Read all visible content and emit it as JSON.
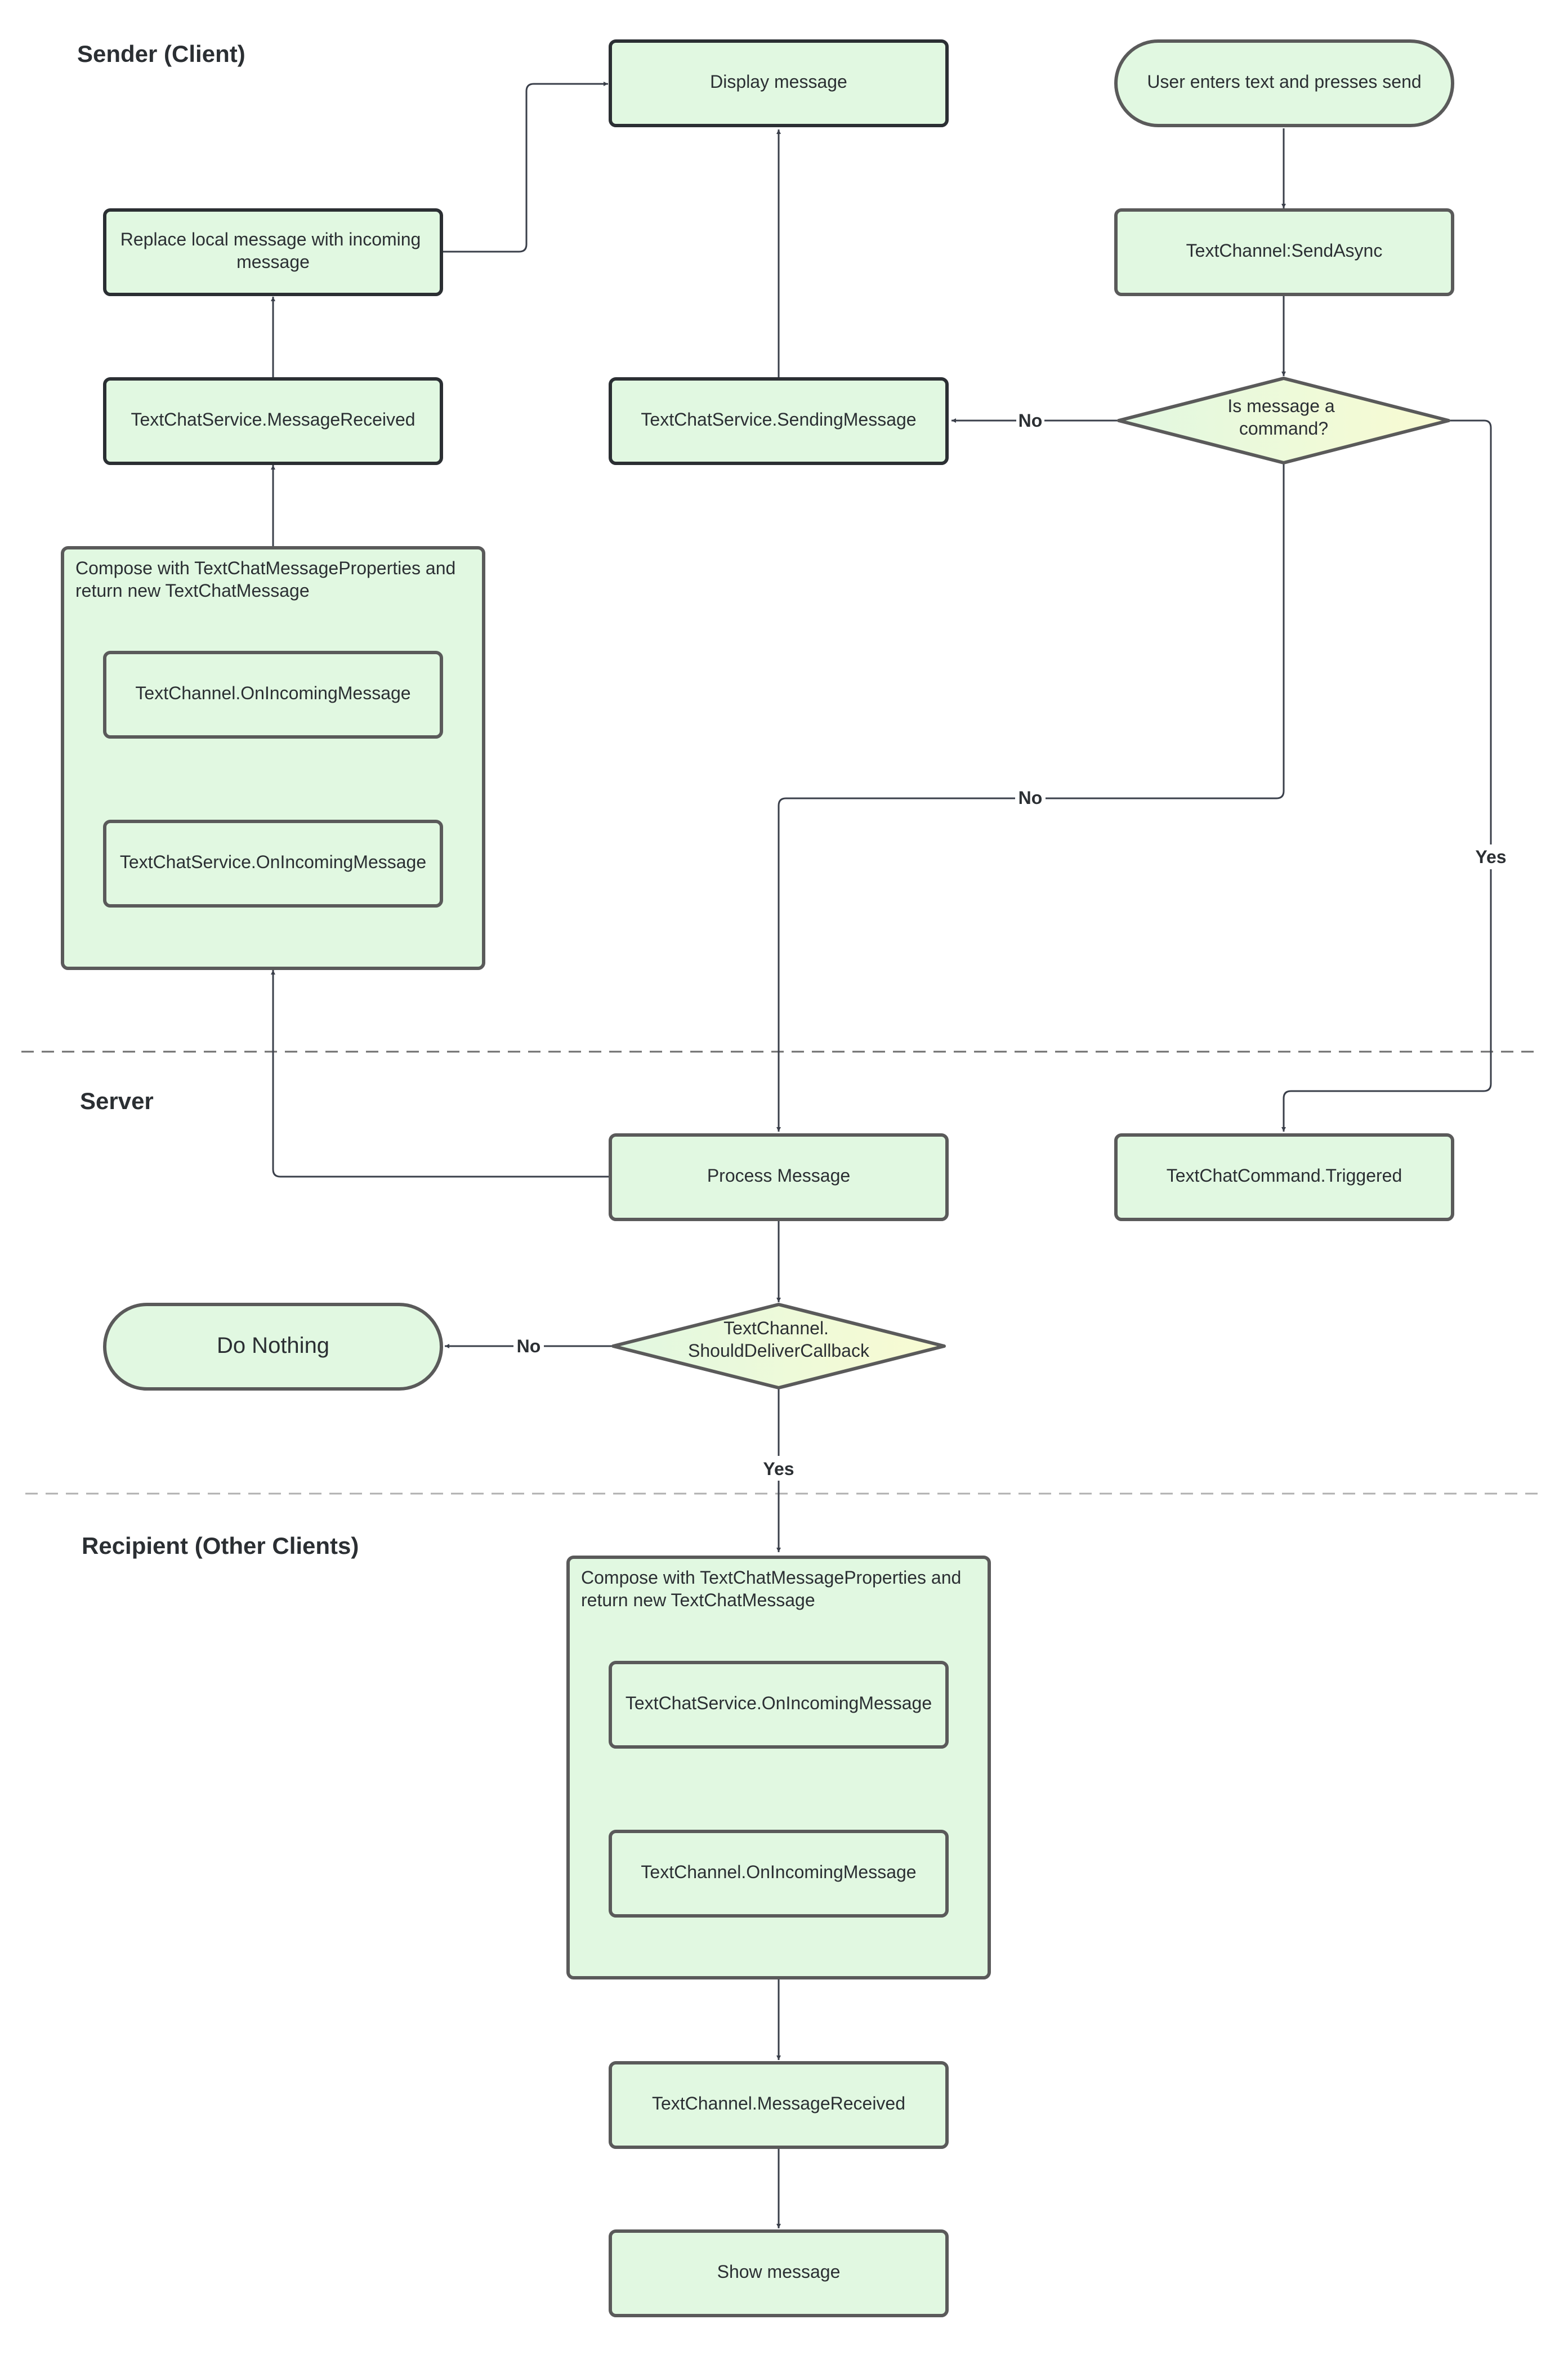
{
  "colors": {
    "node_fill": "#e1f8e1",
    "node_stroke": "#5a5a5a",
    "node_stroke_dark": "#2b2f33",
    "diamond_fill_left": "#e1f8e1",
    "diamond_fill_right": "#f9fbd2",
    "edge": "#3a3f4a",
    "lane_divider": "#8a8a8a"
  },
  "lanes": [
    {
      "id": "sender",
      "title": "Sender (Client)"
    },
    {
      "id": "server",
      "title": "Server"
    },
    {
      "id": "recipient",
      "title": "Recipient (Other Clients)"
    }
  ],
  "nodes": {
    "display_message": {
      "label": "Display message",
      "shape": "process"
    },
    "user_enters_text": {
      "label": "User enters text and presses send",
      "shape": "terminator"
    },
    "replace_local": {
      "label": [
        "Replace local message with incoming",
        "message"
      ],
      "shape": "process"
    },
    "send_async": {
      "label": "TextChannel:SendAsync",
      "shape": "process"
    },
    "chat_message_received": {
      "label": "TextChatService.MessageReceived",
      "shape": "process"
    },
    "sending_message": {
      "label": "TextChatService.SendingMessage",
      "shape": "process"
    },
    "is_command": {
      "label": [
        "Is message a",
        "command?"
      ],
      "shape": "decision"
    },
    "sender_compose_group": {
      "label": [
        "Compose with TextChatMessageProperties and",
        "return new TextChatMessage"
      ],
      "shape": "group"
    },
    "sender_channel_incoming": {
      "label": "TextChannel.OnIncomingMessage",
      "shape": "process"
    },
    "sender_service_incoming": {
      "label": "TextChatService.OnIncomingMessage",
      "shape": "process"
    },
    "process_message": {
      "label": "Process Message",
      "shape": "process"
    },
    "command_triggered": {
      "label": "TextChatCommand.Triggered",
      "shape": "process"
    },
    "should_deliver": {
      "label": [
        "TextChannel.",
        "ShouldDeliverCallback"
      ],
      "shape": "decision"
    },
    "do_nothing": {
      "label": "Do Nothing",
      "shape": "terminator"
    },
    "recipient_compose_group": {
      "label": [
        "Compose with TextChatMessageProperties and",
        "return new TextChatMessage"
      ],
      "shape": "group"
    },
    "recipient_service_incoming": {
      "label": "TextChatService.OnIncomingMessage",
      "shape": "process"
    },
    "recipient_channel_incoming": {
      "label": "TextChannel.OnIncomingMessage",
      "shape": "process"
    },
    "channel_message_received": {
      "label": "TextChannel.MessageReceived",
      "shape": "process"
    },
    "show_message": {
      "label": "Show message",
      "shape": "process"
    }
  },
  "edges": [
    {
      "from": "user_enters_text",
      "to": "send_async",
      "label": ""
    },
    {
      "from": "send_async",
      "to": "is_command",
      "label": ""
    },
    {
      "from": "is_command",
      "to": "sending_message",
      "label": "No"
    },
    {
      "from": "is_command",
      "to": "process_message",
      "label": "No"
    },
    {
      "from": "is_command",
      "to": "command_triggered",
      "label": "Yes"
    },
    {
      "from": "sending_message",
      "to": "display_message",
      "label": ""
    },
    {
      "from": "process_message",
      "to": "sender_compose_group",
      "label": ""
    },
    {
      "from": "sender_service_incoming",
      "to": "sender_channel_incoming",
      "label": ""
    },
    {
      "from": "sender_compose_group",
      "to": "chat_message_received",
      "label": ""
    },
    {
      "from": "chat_message_received",
      "to": "replace_local",
      "label": ""
    },
    {
      "from": "replace_local",
      "to": "display_message",
      "label": ""
    },
    {
      "from": "process_message",
      "to": "should_deliver",
      "label": ""
    },
    {
      "from": "should_deliver",
      "to": "do_nothing",
      "label": "No"
    },
    {
      "from": "should_deliver",
      "to": "recipient_compose_group",
      "label": "Yes"
    },
    {
      "from": "recipient_compose_group",
      "to": "channel_message_received",
      "label": ""
    },
    {
      "from": "channel_message_received",
      "to": "show_message",
      "label": ""
    }
  ]
}
